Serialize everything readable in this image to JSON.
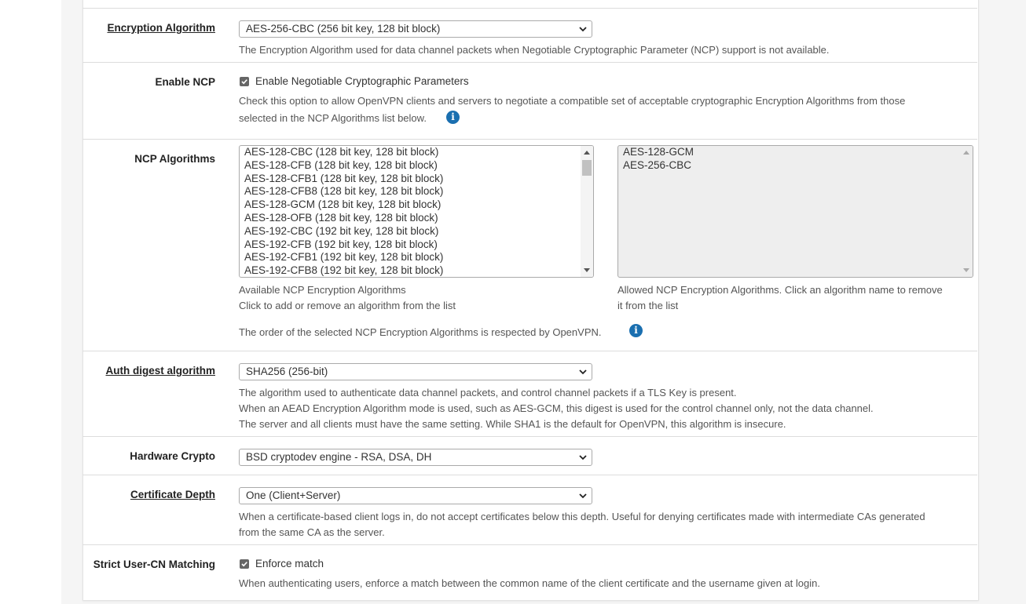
{
  "encryption_algorithm": {
    "label": "Encryption Algorithm",
    "selected": "AES-256-CBC (256 bit key, 128 bit block)",
    "help": "The Encryption Algorithm used for data channel packets when Negotiable Cryptographic Parameter (NCP) support is not available."
  },
  "enable_ncp": {
    "label": "Enable NCP",
    "checkbox_label": "Enable Negotiable Cryptographic Parameters",
    "checked": true,
    "help_line1": "Check this option to allow OpenVPN clients and servers to negotiate a compatible set of acceptable cryptographic Encryption Algorithms from those",
    "help_line2": "selected in the NCP Algorithms list below."
  },
  "ncp_algorithms": {
    "label": "NCP Algorithms",
    "available": [
      "AES-128-CBC (128 bit key, 128 bit block)",
      "AES-128-CFB (128 bit key, 128 bit block)",
      "AES-128-CFB1 (128 bit key, 128 bit block)",
      "AES-128-CFB8 (128 bit key, 128 bit block)",
      "AES-128-GCM (128 bit key, 128 bit block)",
      "AES-128-OFB (128 bit key, 128 bit block)",
      "AES-192-CBC (192 bit key, 128 bit block)",
      "AES-192-CFB (192 bit key, 128 bit block)",
      "AES-192-CFB1 (192 bit key, 128 bit block)",
      "AES-192-CFB8 (192 bit key, 128 bit block)"
    ],
    "allowed": [
      "AES-128-GCM",
      "AES-256-CBC"
    ],
    "available_help1": "Available NCP Encryption Algorithms",
    "available_help2": "Click to add or remove an algorithm from the list",
    "allowed_help1": "Allowed NCP Encryption Algorithms. Click an algorithm name to remove",
    "allowed_help2": "it from the list",
    "order_note": "The order of the selected NCP Encryption Algorithms is respected by OpenVPN."
  },
  "auth_digest": {
    "label": "Auth digest algorithm",
    "selected": "SHA256 (256-bit)",
    "help1": "The algorithm used to authenticate data channel packets, and control channel packets if a TLS Key is present.",
    "help2": "When an AEAD Encryption Algorithm mode is used, such as AES-GCM, this digest is used for the control channel only, not the data channel.",
    "help3": "The server and all clients must have the same setting. While SHA1 is the default for OpenVPN, this algorithm is insecure."
  },
  "hardware_crypto": {
    "label": "Hardware Crypto",
    "selected": "BSD cryptodev engine - RSA, DSA, DH"
  },
  "certificate_depth": {
    "label": "Certificate Depth",
    "selected": "One (Client+Server)",
    "help1": "When a certificate-based client logs in, do not accept certificates below this depth. Useful for denying certificates made with intermediate CAs generated",
    "help2": "from the same CA as the server."
  },
  "strict_cn": {
    "label": "Strict User-CN Matching",
    "checkbox_label": "Enforce match",
    "checked": true,
    "help": "When authenticating users, enforce a match between the common name of the client certificate and the username given at login."
  },
  "colors": {
    "info_blue": "#1a6fb0",
    "border": "#dddddd"
  }
}
